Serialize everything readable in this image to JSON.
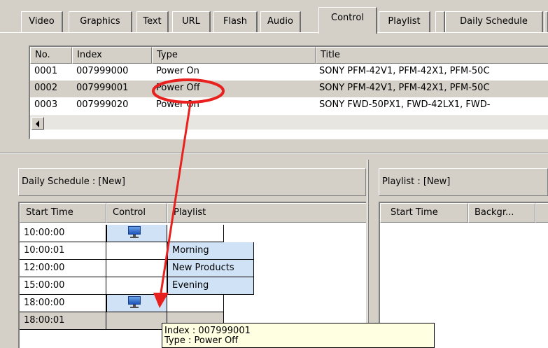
{
  "tabs": [
    {
      "label": "Video"
    },
    {
      "label": "Graphics"
    },
    {
      "label": "Text"
    },
    {
      "label": "URL"
    },
    {
      "label": "Flash"
    },
    {
      "label": "Audio"
    },
    {
      "label": "Control"
    },
    {
      "label": "Playlist"
    },
    {
      "label": ""
    },
    {
      "label": "Daily Schedule"
    }
  ],
  "active_tab": "Control",
  "control_list": {
    "headers": [
      "No.",
      "Index",
      "Type",
      "Title"
    ],
    "rows": [
      {
        "no": "0001",
        "index": "007999000",
        "type": "Power On",
        "title": "SONY PFM-42V1, PFM-42X1, PFM-50C"
      },
      {
        "no": "0002",
        "index": "007999001",
        "type": "Power Off",
        "title": "SONY PFM-42V1, PFM-42X1, PFM-50C"
      },
      {
        "no": "0003",
        "index": "007999020",
        "type": "Power On",
        "title": "SONY FWD-50PX1, FWD-42LX1, FWD-"
      }
    ],
    "selected_row": 1
  },
  "daily_schedule": {
    "title": "Daily Schedule : [New]",
    "headers": [
      "Start Time",
      "Control",
      "Playlist"
    ],
    "rows": [
      {
        "time": "10:00:00",
        "control": "monitor-icon",
        "playlist": ""
      },
      {
        "time": "10:00:01",
        "control": "",
        "playlist": "Morning"
      },
      {
        "time": "12:00:00",
        "control": "",
        "playlist": "New Products"
      },
      {
        "time": "15:00:00",
        "control": "",
        "playlist": "Evening"
      },
      {
        "time": "18:00:00",
        "control": "monitor-icon",
        "playlist": ""
      },
      {
        "time": "18:00:01",
        "control": "",
        "playlist": ""
      }
    ]
  },
  "playlist_panel": {
    "title": "Playlist : [New]",
    "headers": [
      "Start Time",
      "Backgr...",
      ""
    ]
  },
  "tooltip": {
    "line1": "Index : 007999001",
    "line2": "Type : Power Off"
  },
  "colors": {
    "background": "#d4d0c8",
    "playlist_cell": "#cfe2f6",
    "tooltip_bg": "#ffffe1",
    "annotation": "#e8201e",
    "monitor_icon": "#2f6fd6"
  }
}
